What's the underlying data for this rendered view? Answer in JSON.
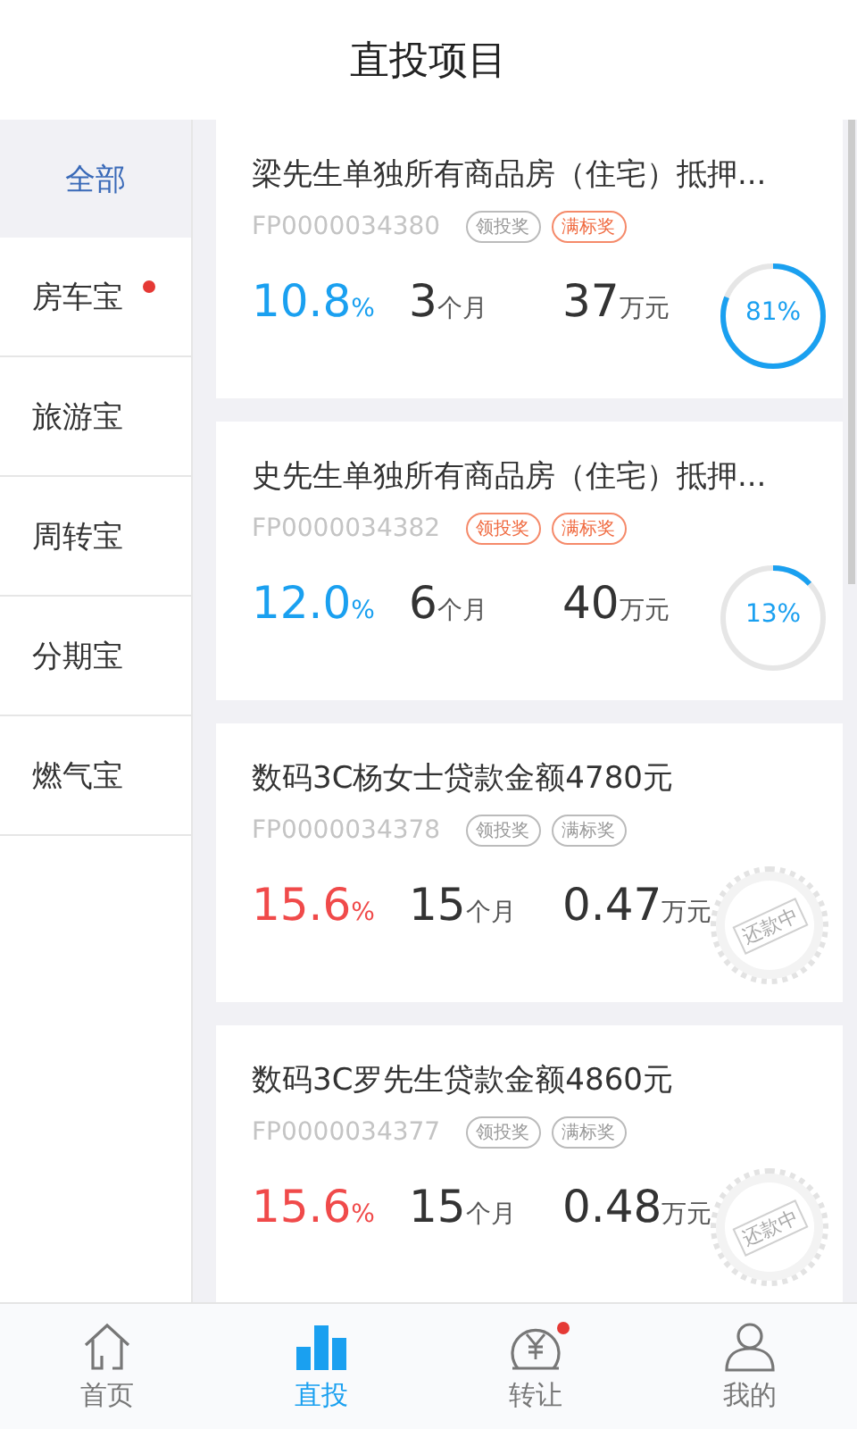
{
  "header": {
    "title": "直投项目"
  },
  "sidebar": {
    "items": [
      {
        "label": "全部",
        "selected": true,
        "dot": false
      },
      {
        "label": "房车宝",
        "selected": false,
        "dot": true
      },
      {
        "label": "旅游宝",
        "selected": false,
        "dot": false
      },
      {
        "label": "周转宝",
        "selected": false,
        "dot": false
      },
      {
        "label": "分期宝",
        "selected": false,
        "dot": false
      },
      {
        "label": "燃气宝",
        "selected": false,
        "dot": false
      }
    ]
  },
  "projects": [
    {
      "title": "梁先生单独所有商品房（住宅）抵押...",
      "code": "FP0000034380",
      "tags": [
        {
          "label": "领投奖",
          "active": false
        },
        {
          "label": "满标奖",
          "active": true
        }
      ],
      "rate": "10.8",
      "rate_unit": "%",
      "color": "#1aa0f0",
      "term": "3",
      "term_unit": "个月",
      "amount": "37",
      "amount_unit": "万元",
      "kind": "progress",
      "level": 0.81,
      "progress_text": "81%"
    },
    {
      "title": "史先生单独所有商品房（住宅）抵押...",
      "code": "FP0000034382",
      "tags": [
        {
          "label": "领投奖",
          "active": true
        },
        {
          "label": "满标奖",
          "active": true
        }
      ],
      "rate": "12.0",
      "rate_unit": "%",
      "color": "#1aa0f0",
      "term": "6",
      "term_unit": "个月",
      "amount": "40",
      "amount_unit": "万元",
      "kind": "progress",
      "level": 0.13,
      "progress_text": "13%"
    },
    {
      "title": "数码3C杨女士贷款金额4780元",
      "code": "FP0000034378",
      "tags": [
        {
          "label": "领投奖",
          "active": false
        },
        {
          "label": "满标奖",
          "active": false
        }
      ],
      "rate": "15.6",
      "rate_unit": "%",
      "color": "#f04a4a",
      "term": "15",
      "term_unit": "个月",
      "amount": "0.47",
      "amount_unit": "万元",
      "kind": "stamp",
      "stamp_text": "还款中"
    },
    {
      "title": "数码3C罗先生贷款金额4860元",
      "code": "FP0000034377",
      "tags": [
        {
          "label": "领投奖",
          "active": false
        },
        {
          "label": "满标奖",
          "active": false
        }
      ],
      "rate": "15.6",
      "rate_unit": "%",
      "color": "#f04a4a",
      "term": "15",
      "term_unit": "个月",
      "amount": "0.48",
      "amount_unit": "万元",
      "kind": "stamp",
      "stamp_text": "还款中"
    }
  ],
  "tabbar": {
    "items": [
      {
        "label": "首页",
        "selected": false,
        "dot": false
      },
      {
        "label": "直投",
        "selected": true,
        "dot": false
      },
      {
        "label": "转让",
        "selected": false,
        "dot": true
      },
      {
        "label": "我的",
        "selected": false,
        "dot": false
      }
    ]
  }
}
